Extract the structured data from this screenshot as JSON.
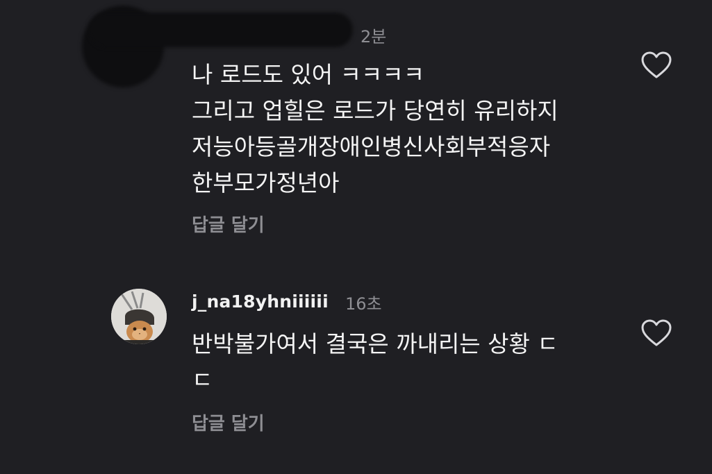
{
  "comments": [
    {
      "username": "",
      "time": "2분",
      "body": "나 로드도 있어 ㅋㅋㅋㅋ\n그리고 업힐은 로드가 당연히 유리하지\n저능아등골개장애인병신사회부적응자\n한부모가정년아",
      "reply_label": "답글 달기",
      "like_icon": "heart-outline-icon",
      "avatar": "redacted"
    },
    {
      "username": "j_na18yhniiiiii",
      "time": "16초",
      "body": "반박불가여서 결국은 까내리는 상황 ㄷ\nㄷ",
      "reply_label": "답글 달기",
      "like_icon": "heart-outline-icon",
      "avatar": "cat-avatar"
    }
  ],
  "colors": {
    "background": "#1f1f23",
    "text": "#f2f2f2",
    "muted": "#8e8e93"
  }
}
